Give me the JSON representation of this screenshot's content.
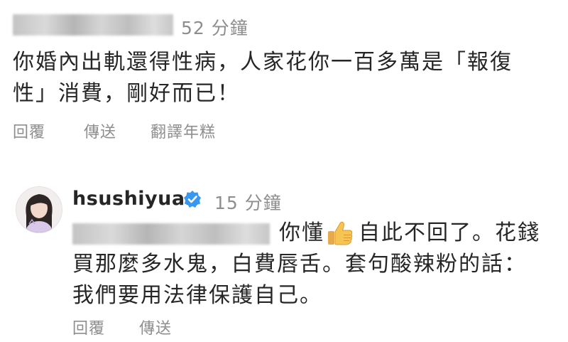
{
  "comment1": {
    "timestamp": "52 分鐘",
    "text_line1": "你婚內出軌還得性病，人家花你一百多萬是「報復",
    "text_line2": "性」消費，剛好而已！",
    "actions": [
      "回覆",
      "傳送",
      "翻譯年糕"
    ]
  },
  "comment2": {
    "username": "hsushiyuan",
    "verified": true,
    "timestamp": "15 分鐘",
    "line1_a": "你懂",
    "emoji": "thumbs-up-icon",
    "line1_b": "自此不回了。花錢",
    "line2": "買那麼多水鬼，白費唇舌。套句酸辣粉的話：",
    "line3": "我們要用法律保護自己。",
    "actions": [
      "回覆",
      "傳送"
    ]
  },
  "colors": {
    "text": "#262626",
    "secondary": "#8e8e8e",
    "verified_blue": "#3897f0"
  }
}
